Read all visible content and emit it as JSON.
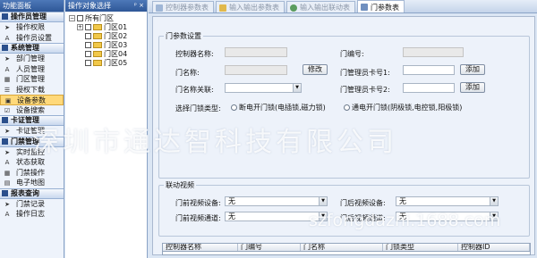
{
  "left_panel": {
    "title": "功能面板",
    "groups": [
      {
        "title": "操作员管理",
        "items": [
          {
            "label": "操作权限",
            "icon": "arrow-cursor-icon"
          },
          {
            "label": "操作员设置",
            "icon": "font-a-icon"
          }
        ]
      },
      {
        "title": "系统管理",
        "items": [
          {
            "label": "部门管理",
            "icon": "arrow-cursor-icon"
          },
          {
            "label": "人员管理",
            "icon": "font-a-icon"
          },
          {
            "label": "门区管理",
            "icon": "grid-icon"
          },
          {
            "label": "授权下载",
            "icon": "check-list-icon"
          },
          {
            "label": "设备参数",
            "icon": "device-icon"
          },
          {
            "label": "设备搜索",
            "icon": "check-icon"
          }
        ]
      },
      {
        "title": "卡证管理",
        "items": [
          {
            "label": "卡证管理",
            "icon": "arrow-cursor-icon"
          }
        ]
      },
      {
        "title": "门禁管理",
        "items": [
          {
            "label": "实时监控",
            "icon": "arrow-cursor-icon"
          },
          {
            "label": "状态获取",
            "icon": "font-a-icon"
          },
          {
            "label": "门禁操作",
            "icon": "grid-icon"
          },
          {
            "label": "电子地图",
            "icon": "map-icon"
          }
        ]
      },
      {
        "title": "报表查询",
        "items": [
          {
            "label": "门禁记录",
            "icon": "arrow-cursor-icon"
          },
          {
            "label": "操作日志",
            "icon": "font-a-icon"
          }
        ]
      }
    ],
    "selected": "设备参数"
  },
  "tree_panel": {
    "title": "操作对象选择",
    "pin": "ᵖ ×",
    "root": "所有门区",
    "nodes": [
      "门区01",
      "门区02",
      "门区03",
      "门区04",
      "门区05"
    ]
  },
  "tabs": [
    {
      "label": "控制器参数表",
      "active": false
    },
    {
      "label": "输入输出参数表",
      "active": false
    },
    {
      "label": "输入输出联动表",
      "active": false
    },
    {
      "label": "门参数表",
      "active": true
    }
  ],
  "door_settings": {
    "legend": "门参数设置",
    "controller_name_label": "控制器名称:",
    "door_number_label": "门编号:",
    "door_name_label": "门名称:",
    "modify_button": "修改",
    "admin_card1_label": "门管理员卡号1:",
    "add_button1": "添加",
    "door_name_link_label": "门名称关联:",
    "admin_card2_label": "门管理员卡号2:",
    "add_button2": "添加",
    "lock_type_label": "选择门锁类型:",
    "lock_option1": "断电开门锁(电插锁,磁力锁)",
    "lock_option2": "通电开门锁(阴极锁,电控锁,阳极锁)"
  },
  "video_link": {
    "legend": "联动视频",
    "front_device_label": "门前视频设备:",
    "front_device_value": "无",
    "back_device_label": "门后视频设备:",
    "back_device_value": "无",
    "front_channel_label": "门前视频通道:",
    "front_channel_value": "无",
    "back_channel_label": "门后视频通道:",
    "back_channel_value": "无"
  },
  "grid": {
    "columns": [
      "控制器名称",
      "门编号",
      "门名称",
      "门锁类型",
      "控制器ID"
    ]
  },
  "watermark": {
    "line1": "深圳市通达智科技有限公司",
    "line2": "szfongdazhi.1688.com"
  }
}
